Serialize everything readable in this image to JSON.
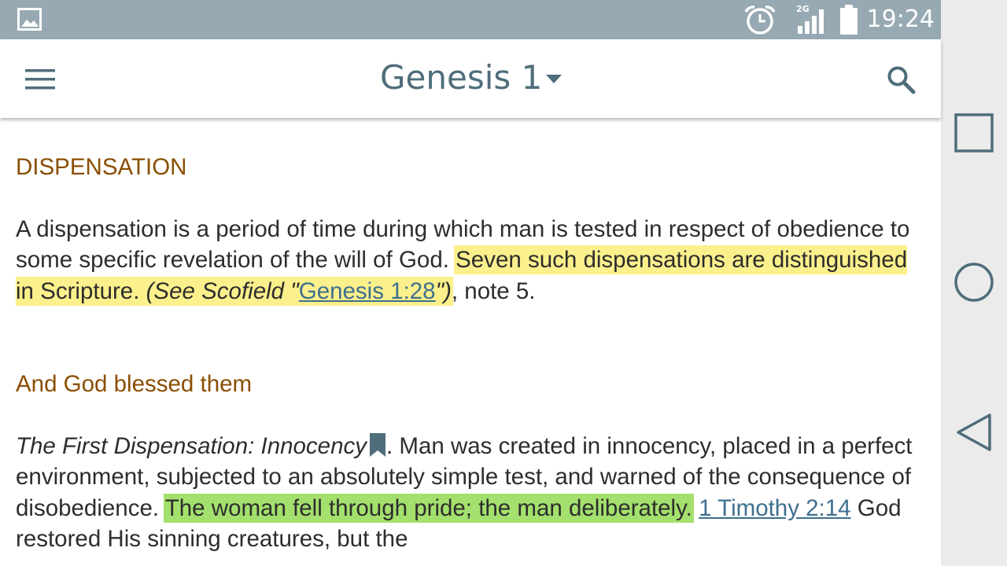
{
  "status_bar": {
    "time": "19:24",
    "network": "2G",
    "icons": [
      "gallery-icon",
      "alarm-icon",
      "signal-icon",
      "battery-icon"
    ]
  },
  "app_bar": {
    "title": "Genesis 1",
    "menu_icon": "hamburger-menu-icon",
    "dropdown_icon": "dropdown-arrow-icon",
    "search_icon": "search-icon"
  },
  "content": {
    "section1": {
      "heading": "DISPENSATION",
      "text_part1": "A dispensation is a period of time during which man is tested in respect of obedience to some specific revelation of the will of God.",
      "highlight": "Seven such dispensations are distinguished in Scripture.",
      "see_prefix": "(See Scofield \"",
      "link": "Genesis 1:28",
      "see_suffix": "\")",
      "note": ", note 5."
    },
    "section2": {
      "heading": "And God blessed them",
      "italic_title": "The First Dispensation: Innocency",
      "text_part1": ". Man was created in innocency, placed in a perfect environment, subjected to an absolutely simple test, and warned of the consequence of disobedience.",
      "highlight": "The woman fell through pride; the man deliberately.",
      "link": "1 Timothy 2:14",
      "text_part2": "God restored His sinning creatures, but the"
    }
  },
  "colors": {
    "status_bar": "#97a9b2",
    "title": "#4f6d7a",
    "heading": "#8a4e00",
    "highlight_yellow": "#fbf08c",
    "highlight_green": "#a4e06d",
    "link": "#3e6f8f"
  },
  "nav_bar": {
    "buttons": [
      "recents-square-icon",
      "home-circle-icon",
      "back-triangle-icon"
    ]
  }
}
